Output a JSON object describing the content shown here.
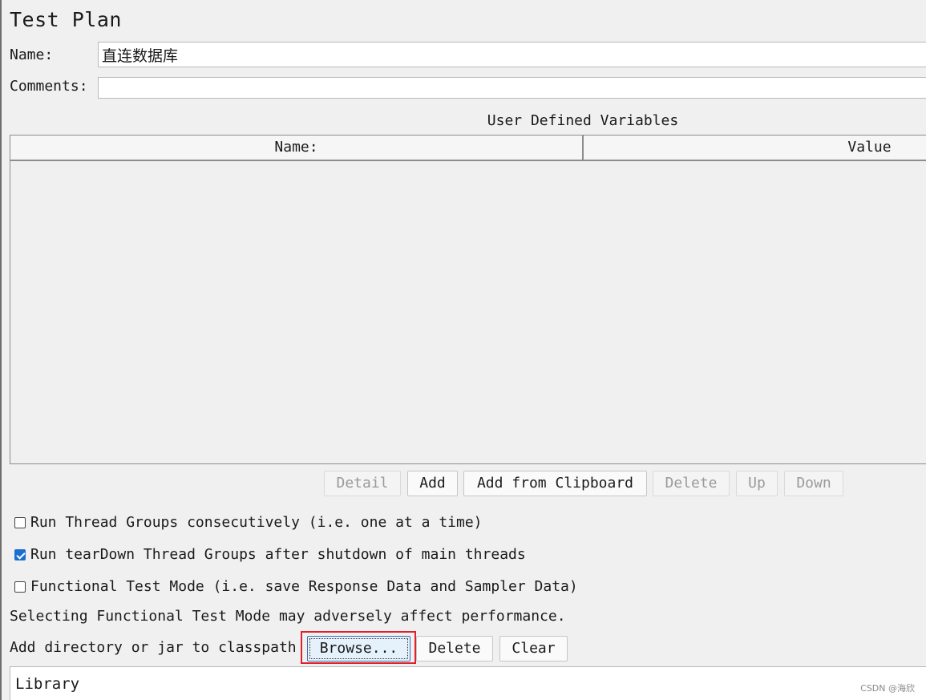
{
  "title": "Test Plan",
  "name_label": "Name:",
  "name_value": "直连数据库",
  "comments_label": "Comments:",
  "comments_value": "",
  "udv": {
    "title": "User Defined Variables",
    "columns": [
      "Name:",
      "Value"
    ],
    "rows": []
  },
  "table_buttons": [
    {
      "label": "Detail",
      "enabled": false
    },
    {
      "label": "Add",
      "enabled": true
    },
    {
      "label": "Add from Clipboard",
      "enabled": true
    },
    {
      "label": "Delete",
      "enabled": false
    },
    {
      "label": "Up",
      "enabled": false
    },
    {
      "label": "Down",
      "enabled": false
    }
  ],
  "options": [
    {
      "label": "Run Thread Groups consecutively (i.e. one at a time)",
      "checked": false
    },
    {
      "label": "Run tearDown Thread Groups after shutdown of main threads",
      "checked": true
    },
    {
      "label": "Functional Test Mode (i.e. save Response Data and Sampler Data)",
      "checked": false
    }
  ],
  "functional_note": "Selecting Functional Test Mode may adversely affect performance.",
  "classpath": {
    "label": "Add directory or jar to classpath",
    "browse": "Browse...",
    "delete": "Delete",
    "clear": "Clear",
    "library_header": "Library"
  },
  "watermark": "CSDN @海欣",
  "colors": {
    "background": "#f0f0f0",
    "checkbox_checked": "#1a6fd0",
    "highlight_box": "#e0202a"
  }
}
